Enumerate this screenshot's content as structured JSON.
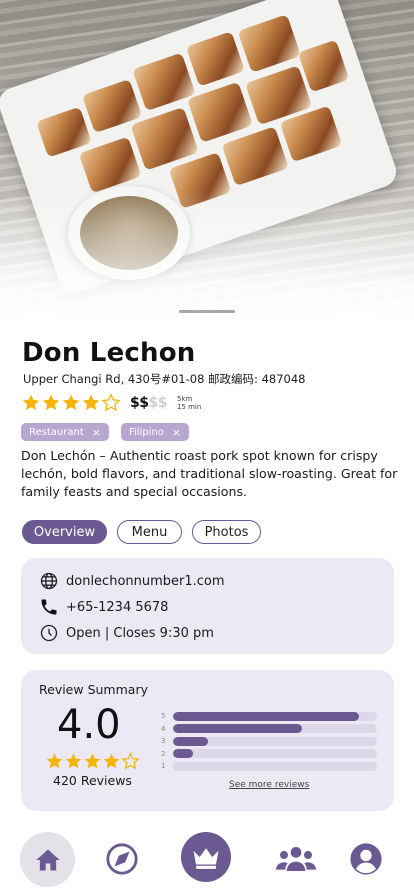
{
  "restaurant": {
    "name": "Don Lechon",
    "address": "Upper Changi Rd, 430号#01-08 邮政编码: 487048",
    "rating_stars": 4,
    "price_active": "$$",
    "price_inactive": "$$",
    "distance": "5km",
    "travel_time": "15 min",
    "tags": [
      {
        "label": "Restaurant",
        "remove": "×"
      },
      {
        "label": "Filipino",
        "remove": "×"
      }
    ],
    "description": "Don Lechón – Authentic roast pork spot known for crispy lechón, bold flavors, and traditional slow-roasting. Great for family feasts and special occasions."
  },
  "tabs": [
    {
      "label": "Overview",
      "active": true
    },
    {
      "label": "Menu",
      "active": false
    },
    {
      "label": "Photos",
      "active": false
    }
  ],
  "contact": {
    "website": "donlechonnumber1.com",
    "phone": "+65-1234 5678",
    "hours": "Open | Closes 9:30 pm"
  },
  "reviews": {
    "title": "Review Summary",
    "average": "4.0",
    "stars": 4,
    "count_label": "420 Reviews",
    "distribution": [
      {
        "stars": "5",
        "fraction": 0.91
      },
      {
        "stars": "4",
        "fraction": 0.63
      },
      {
        "stars": "3",
        "fraction": 0.17
      },
      {
        "stars": "2",
        "fraction": 0.1
      },
      {
        "stars": "1",
        "fraction": 0.0
      }
    ],
    "see_more": "See more reviews"
  },
  "nav": {
    "items": [
      "home-icon",
      "explore-compass-icon",
      "crown-icon",
      "community-icon",
      "profile-icon"
    ]
  },
  "colors": {
    "accent": "#6b5a92",
    "star": "#f4b400",
    "card_bg": "#ece8f4",
    "tag_bg": "#b7a6cf"
  }
}
